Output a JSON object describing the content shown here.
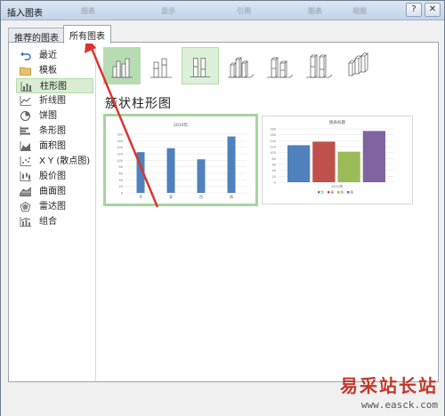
{
  "window": {
    "title": "插入图表",
    "ghost_labels": [
      "图表",
      "显示",
      "引用",
      "图表",
      "视图"
    ],
    "help_label": "?",
    "close_label": "✕"
  },
  "tabs": [
    {
      "label": "推荐的图表"
    },
    {
      "label": "所有图表"
    }
  ],
  "sidebar": {
    "items": [
      {
        "label": "最近",
        "icon": "undo-arrow-icon"
      },
      {
        "label": "模板",
        "icon": "folder-icon"
      },
      {
        "label": "柱形图",
        "icon": "column-chart-icon"
      },
      {
        "label": "折线图",
        "icon": "line-chart-icon"
      },
      {
        "label": "饼图",
        "icon": "pie-chart-icon"
      },
      {
        "label": "条形图",
        "icon": "bar-chart-icon"
      },
      {
        "label": "面积图",
        "icon": "area-chart-icon"
      },
      {
        "label": "X Y (散点图)",
        "icon": "scatter-chart-icon"
      },
      {
        "label": "股价图",
        "icon": "stock-chart-icon"
      },
      {
        "label": "曲面图",
        "icon": "surface-chart-icon"
      },
      {
        "label": "雷达图",
        "icon": "radar-chart-icon"
      },
      {
        "label": "组合",
        "icon": "combo-chart-icon"
      }
    ],
    "selected": "柱形图"
  },
  "subtypes": [
    "clustered-column-icon",
    "stacked-column-icon",
    "percent-stacked-column-icon",
    "3d-clustered-column-icon",
    "3d-stacked-column-icon",
    "3d-percent-stacked-column-icon",
    "3d-column-icon"
  ],
  "subtitle": "簇状柱形图",
  "chart_data": [
    {
      "type": "bar",
      "title": "2010年",
      "categories": [
        "华",
        "東",
        "西",
        "南"
      ],
      "values": [
        125,
        137,
        103,
        173
      ],
      "ylim": [
        0,
        180
      ],
      "yticks": [
        0,
        20,
        40,
        60,
        80,
        100,
        120,
        140,
        160,
        180
      ],
      "color": "#4f81bd"
    },
    {
      "type": "bar",
      "title": "图表标题",
      "xlabel": "2010年",
      "categories": [
        ""
      ],
      "series": [
        {
          "name": "华",
          "values": [
            125
          ],
          "color": "#4f81bd"
        },
        {
          "name": "東",
          "values": [
            137
          ],
          "color": "#c0504d"
        },
        {
          "name": "西",
          "values": [
            103
          ],
          "color": "#9bbb59"
        },
        {
          "name": "南",
          "values": [
            173
          ],
          "color": "#8064a2"
        }
      ],
      "ylim": [
        0,
        180
      ],
      "yticks": [
        0,
        20,
        40,
        60,
        80,
        100,
        120,
        140,
        160,
        180
      ]
    }
  ],
  "watermark": {
    "text": "易采站长站",
    "url": "www.easck.com"
  },
  "colors": {
    "selection_green": "#b7dcb1",
    "arrow_red": "#d9372e"
  }
}
